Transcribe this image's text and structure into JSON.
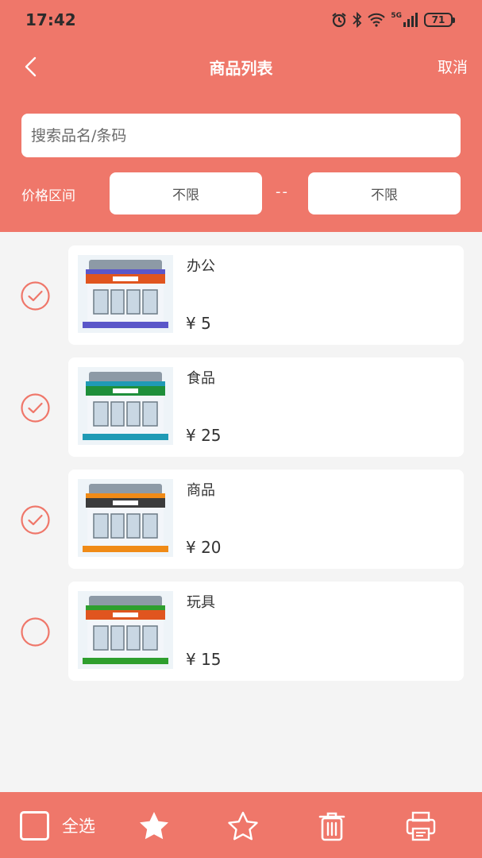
{
  "status_bar": {
    "time": "17:42",
    "network": "5G",
    "battery": "71",
    "icons": [
      "alarm-icon",
      "bluetooth-icon",
      "wifi-icon",
      "signal-icon",
      "battery-icon"
    ]
  },
  "nav": {
    "title": "商品列表",
    "cancel_label": "取消",
    "back_icon": "chevron-left-icon"
  },
  "search": {
    "placeholder": "搜索品名/条码",
    "value": ""
  },
  "price_filter": {
    "label": "价格区间",
    "min_value": "不限",
    "separator": "--",
    "max_value": "不限"
  },
  "products": [
    {
      "name": "办公",
      "price": "¥ 5",
      "checked": true,
      "accent": "#e0551f",
      "base": "#5b57c9"
    },
    {
      "name": "食品",
      "price": "¥ 25",
      "checked": true,
      "accent": "#1e8f3a",
      "base": "#1f9ab5"
    },
    {
      "name": "商品",
      "price": "¥ 20",
      "checked": true,
      "accent": "#3b3b3b",
      "base": "#f08b17"
    },
    {
      "name": "玩具",
      "price": "¥ 15",
      "checked": false,
      "accent": "#e0551f",
      "base": "#2e9f2e"
    }
  ],
  "bottom_bar": {
    "select_all_label": "全选",
    "icons": [
      "star-filled-icon",
      "star-outline-icon",
      "trash-icon",
      "print-icon"
    ]
  },
  "colors": {
    "primary": "#ef776a",
    "background": "#f4f4f4",
    "card": "#ffffff"
  }
}
